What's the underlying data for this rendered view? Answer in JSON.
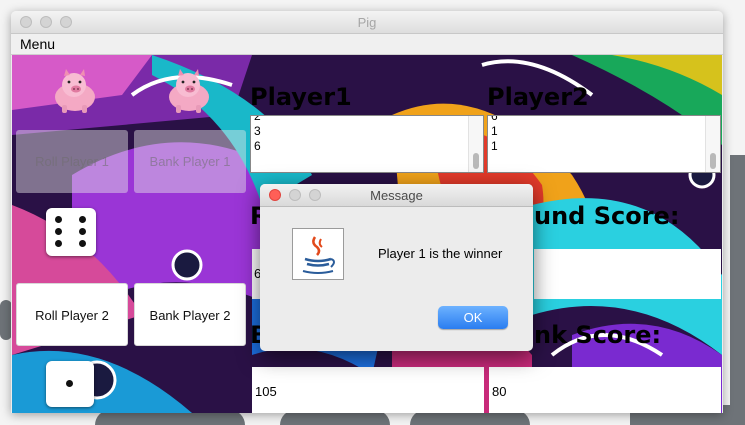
{
  "window": {
    "title": "Pig"
  },
  "menubar": {
    "menu_label": "Menu"
  },
  "left_panel": {
    "roll_player1_label": "Roll Player 1",
    "bank_player1_label": "Bank Player 1",
    "roll_player2_label": "Roll Player 2",
    "bank_player2_label": "Bank Player 2",
    "die_player1_value": 6,
    "die_player2_value": 1
  },
  "player1": {
    "heading": "Player1",
    "rolls": [
      "2",
      "3",
      "6"
    ],
    "round_score_label_fragment": "R",
    "round_score_value_fragment": "6",
    "bank_score_label_fragment": "B",
    "bank_score_value": "105"
  },
  "player2": {
    "heading": "Player2",
    "rolls": [
      "6",
      "1",
      "1"
    ],
    "round_score_label_fragment": "und Score:",
    "bank_score_label_fragment": "nk Score:",
    "bank_score_value": "80"
  },
  "dialog": {
    "title": "Message",
    "message": "Player 1 is the winner",
    "ok_label": "OK",
    "icon": "java-coffee-cup-icon"
  },
  "icons": {
    "pig": "pig-icon",
    "die": "die-icon"
  },
  "colors": {
    "dialog_close": "#ff5f57",
    "ok_button": "#3b8ff6",
    "desktop_bar": "#6e7378"
  }
}
